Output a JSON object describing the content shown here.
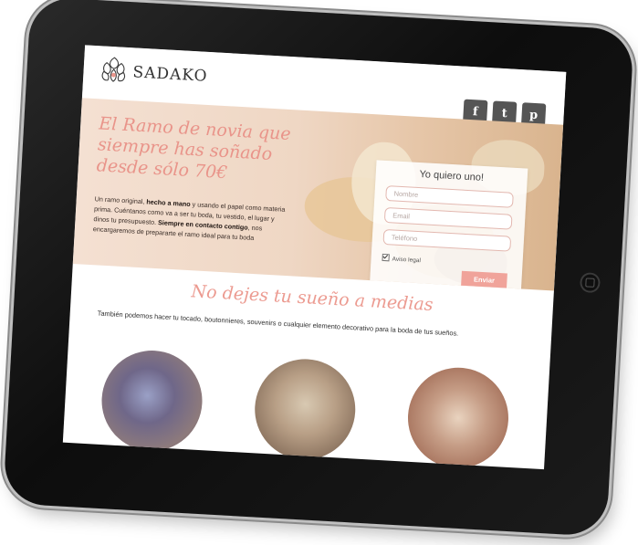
{
  "header": {
    "brand": "SADAKO",
    "social": [
      "f",
      "t",
      "p"
    ],
    "social_icons": [
      "facebook-icon",
      "twitter-icon",
      "pinterest-icon"
    ]
  },
  "hero": {
    "title_lines": [
      "El Ramo de novia que",
      "siempre has soñado",
      "desde sólo 70€"
    ],
    "text": {
      "p1": "Un ramo original, ",
      "b1": "hecho a mano",
      "p2": " y usando el papel como materia prima. Cuéntanos como va a ser tu boda, tu vestido, el lugar y dinos tu presupuesto. ",
      "b2": "Siempre en contacto contigo",
      "p3": ", nos encargaremos de prepararte el ramo ideal para tu boda"
    }
  },
  "form": {
    "title": "Yo quiero uno!",
    "name_placeholder": "Nombre",
    "email_placeholder": "Email",
    "phone_placeholder": "Teléfono",
    "legal_label": "Aviso legal",
    "submit_label": "Enviar"
  },
  "section": {
    "title": "No dejes tu sueño a medias",
    "text": "También podemos hacer tu tocado, boutonnieres, souvenirs o cualquier elemento decorativo para la boda de tus sueños."
  },
  "colors": {
    "accent": "#ec9b91",
    "button": "#f0a39a",
    "social_bg": "#555555"
  }
}
